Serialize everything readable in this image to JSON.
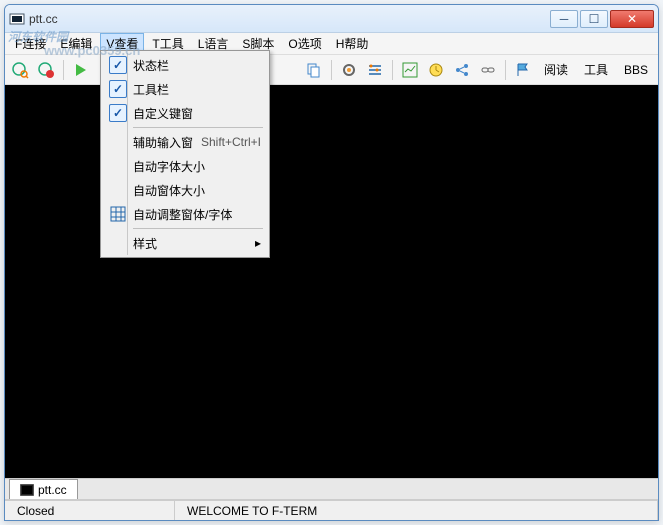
{
  "watermark": {
    "line1": "河东软件园",
    "line2": "www.pc0359.cn"
  },
  "window": {
    "title": "ptt.cc"
  },
  "winbtns": {
    "min": "─",
    "max": "☐",
    "close": "✕"
  },
  "menubar": [
    "F连接",
    "E编辑",
    "V查看",
    "T工具",
    "L语言",
    "S脚本",
    "O选项",
    "H帮助"
  ],
  "menubar_active_index": 2,
  "dropdown": {
    "items": [
      {
        "label": "状态栏",
        "checked": true
      },
      {
        "label": "工具栏",
        "checked": true
      },
      {
        "label": "自定义键窗",
        "checked": true
      },
      {
        "sep": true
      },
      {
        "label": "辅助输入窗",
        "accel": "Shift+Ctrl+I"
      },
      {
        "label": "自动字体大小"
      },
      {
        "label": "自动窗体大小"
      },
      {
        "label": "自动调整窗体/字体",
        "icon": "grid"
      },
      {
        "sep": true
      },
      {
        "label": "样式",
        "submenu": true
      }
    ]
  },
  "toolbar_text": {
    "read": "阅读",
    "tool": "工具",
    "bbs": "BBS"
  },
  "tab": {
    "label": "ptt.cc"
  },
  "status": {
    "left": "Closed",
    "center": "WELCOME TO F-TERM"
  }
}
